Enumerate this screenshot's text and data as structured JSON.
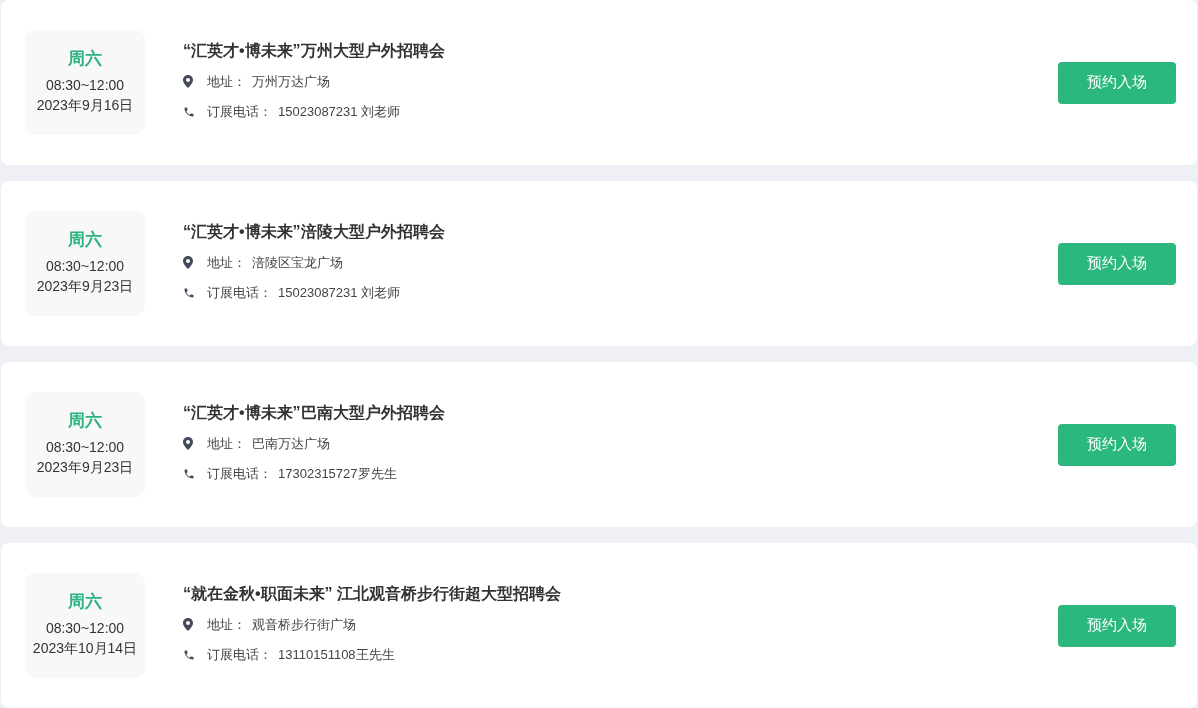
{
  "events": [
    {
      "weekday": "周六",
      "time": "08:30~12:00",
      "date": "2023年9月16日",
      "title": "“汇英才•博未来”万州大型户外招聘会",
      "address_label": "地址：",
      "address": "万州万达广场",
      "phone_label": "订展电话：",
      "phone": "15023087231 刘老师",
      "button": "预约入场"
    },
    {
      "weekday": "周六",
      "time": "08:30~12:00",
      "date": "2023年9月23日",
      "title": "“汇英才•博未来”涪陵大型户外招聘会",
      "address_label": "地址：",
      "address": "涪陵区宝龙广场",
      "phone_label": "订展电话：",
      "phone": "15023087231 刘老师",
      "button": "预约入场"
    },
    {
      "weekday": "周六",
      "time": "08:30~12:00",
      "date": "2023年9月23日",
      "title": "“汇英才•博未来”巴南大型户外招聘会",
      "address_label": "地址：",
      "address": "巴南万达广场",
      "phone_label": "订展电话：",
      "phone": "17302315727罗先生",
      "button": "预约入场"
    },
    {
      "weekday": "周六",
      "time": "08:30~12:00",
      "date": "2023年10月14日",
      "title": "“就在金秋•职面未来” 江北观音桥步行街超大型招聘会",
      "address_label": "地址：",
      "address": "观音桥步行街广场",
      "phone_label": "订展电话：",
      "phone": "13110151108王先生",
      "button": "预约入场"
    }
  ]
}
